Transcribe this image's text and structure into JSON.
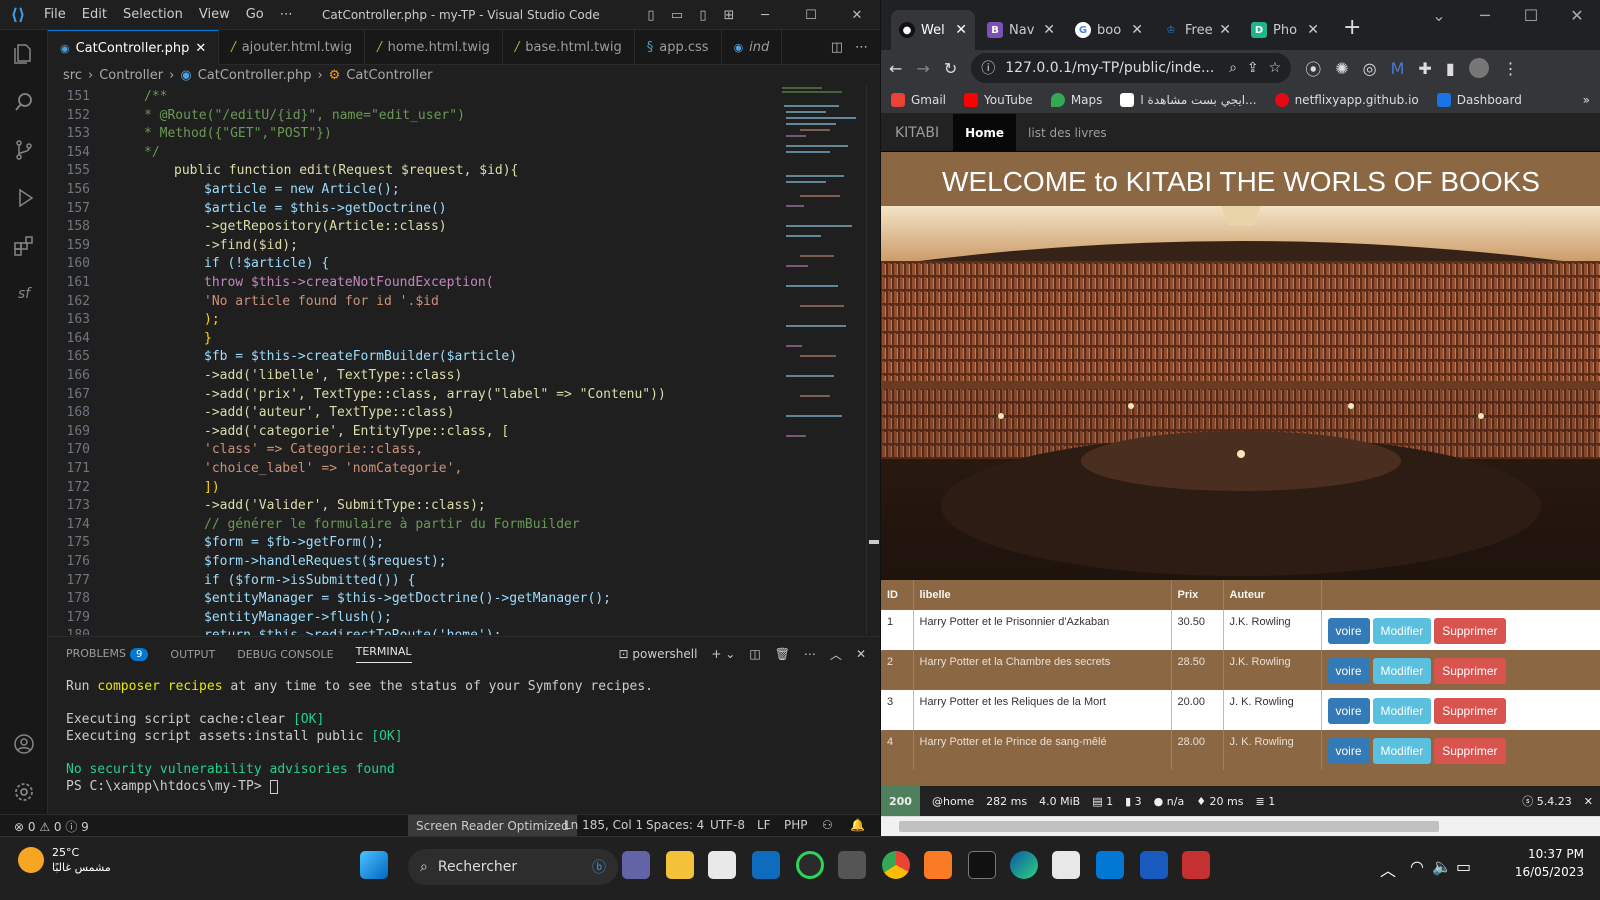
{
  "vscode": {
    "menus": [
      "File",
      "Edit",
      "Selection",
      "View",
      "Go",
      "⋯"
    ],
    "title": "CatController.php - my-TP - Visual Studio Code",
    "tabs": [
      {
        "label": "CatController.php"
      },
      {
        "label": "ajouter.html.twig"
      },
      {
        "label": "home.html.twig"
      },
      {
        "label": "base.html.twig"
      },
      {
        "label": "app.css"
      },
      {
        "label": "ind"
      }
    ],
    "breadcrumb": [
      "src",
      "Controller",
      "CatController.php",
      "CatController"
    ],
    "line_numbers": [
      "151",
      "152",
      "153",
      "154",
      "155",
      "156",
      "157",
      "158",
      "159",
      "160",
      "161",
      "162",
      "163",
      "164",
      "165",
      "166",
      "167",
      "168",
      "169",
      "170",
      "171",
      "172",
      "173",
      "174",
      "175",
      "176",
      "177",
      "178",
      "179",
      "180"
    ],
    "code": [
      "/**",
      "* @Route(\"/editU/{id}\", name=\"edit_user\")",
      "* Method({\"GET\",\"POST\"})",
      "*/",
      "public function edit(Request $request, $id){",
      "$article = new Article();",
      "$article = $this->getDoctrine()",
      "->getRepository(Article::class)",
      "->find($id);",
      "if (!$article) {",
      "throw $this->createNotFoundException(",
      "'No article found for id '.$id",
      ");",
      "}",
      "$fb = $this->createFormBuilder($article)",
      "->add('libelle', TextType::class)",
      "->add('prix', TextType::class, array(\"label\" => \"Contenu\"))",
      "->add('auteur', TextType::class)",
      "->add('categorie', EntityType::class, [",
      "'class' => Categorie::class,",
      "'choice_label' => 'nomCategorie',",
      "])",
      "->add('Valider', SubmitType::class);",
      "// générer le formulaire à partir du FormBuilder",
      "$form = $fb->getForm();",
      "$form->handleRequest($request);",
      "if ($form->isSubmitted()) {",
      "$entityManager = $this->getDoctrine()->getManager();",
      "$entityManager->flush();",
      "return $this->redirectToRoute('home');"
    ],
    "panel_tabs": {
      "problems": "PROBLEMS",
      "problems_count": "9",
      "output": "OUTPUT",
      "debug": "DEBUG CONSOLE",
      "terminal": "TERMINAL",
      "shell": "powershell"
    },
    "terminal": {
      "l1a": "Run ",
      "l1b": "composer recipes",
      "l1c": " at any time to see the status of your Symfony recipes.",
      "l2": "Executing script cache:clear",
      "l2ok": "[OK]",
      "l3": "Executing script assets:install public",
      "l3ok": "[OK]",
      "l4": "No security vulnerability advisories found",
      "l5": "PS C:\\xampp\\htdocs\\my-TP> "
    },
    "status": {
      "errors": "⊗ 0 ⚠ 0 ⓘ 9",
      "sr": "Screen Reader Optimized",
      "pos": "Ln 185, Col 1",
      "spaces": "Spaces: 4",
      "enc": "UTF-8",
      "eol": "LF",
      "lang": "PHP"
    }
  },
  "chrome": {
    "tabs": [
      {
        "fav": "●",
        "label": "Wel"
      },
      {
        "fav": "B",
        "label": "Nav"
      },
      {
        "fav": "G",
        "label": "boo"
      },
      {
        "fav": "♔",
        "label": "Free"
      },
      {
        "fav": "D",
        "label": "Pho"
      }
    ],
    "url": "127.0.0.1/my-TP/public/inde...",
    "bookmarks": [
      "Gmail",
      "YouTube",
      "Maps",
      "ايجي بست مشاهدة ا...",
      "netflixyapp.github.io",
      "Dashboard"
    ],
    "colors": {
      "gmail": "#ea4335",
      "youtube": "#ff0000",
      "maps": "#34a853",
      "egy": "#ffffff",
      "netflix": "#e50914",
      "dash": "#1a73e8"
    }
  },
  "site": {
    "brand": "KITABI",
    "nav_home": "Home",
    "nav_books": "list des livres",
    "welcome": "WELCOME to KITABI THE WORLS OF BOOKS",
    "table_headers": [
      "ID",
      "libelle",
      "Prix",
      "Auteur"
    ],
    "rows": [
      {
        "id": "1",
        "libelle": "Harry Potter et le Prisonnier d'Azkaban",
        "prix": "30.50",
        "auteur": "J.K. Rowling"
      },
      {
        "id": "2",
        "libelle": "Harry Potter et la Chambre des secrets",
        "prix": "28.50",
        "auteur": "J.K. Rowling"
      },
      {
        "id": "3",
        "libelle": "Harry Potter et les Reliques de la Mort",
        "prix": "20.00",
        "auteur": "J. K. Rowling"
      },
      {
        "id": "4",
        "libelle": "Harry Potter et le Prince de sang-mêlé",
        "prix": "28.00",
        "auteur": "J. K. Rowling"
      }
    ],
    "btn_voir": "voire",
    "btn_mod": "Modifier",
    "btn_sup": "Supprimer"
  },
  "profiler": {
    "status": "200",
    "route": "@home",
    "time": "282 ms",
    "mem": "4.0 MiB",
    "forms": "1",
    "cache": "3",
    "user": "n/a",
    "t2": "20 ms",
    "db": "1",
    "version": "5.4.23"
  },
  "taskbar": {
    "temp": "25°C",
    "cond": "مشمس غالبًا",
    "search": "Rechercher",
    "time": "10:37 PM",
    "date": "16/05/2023"
  }
}
